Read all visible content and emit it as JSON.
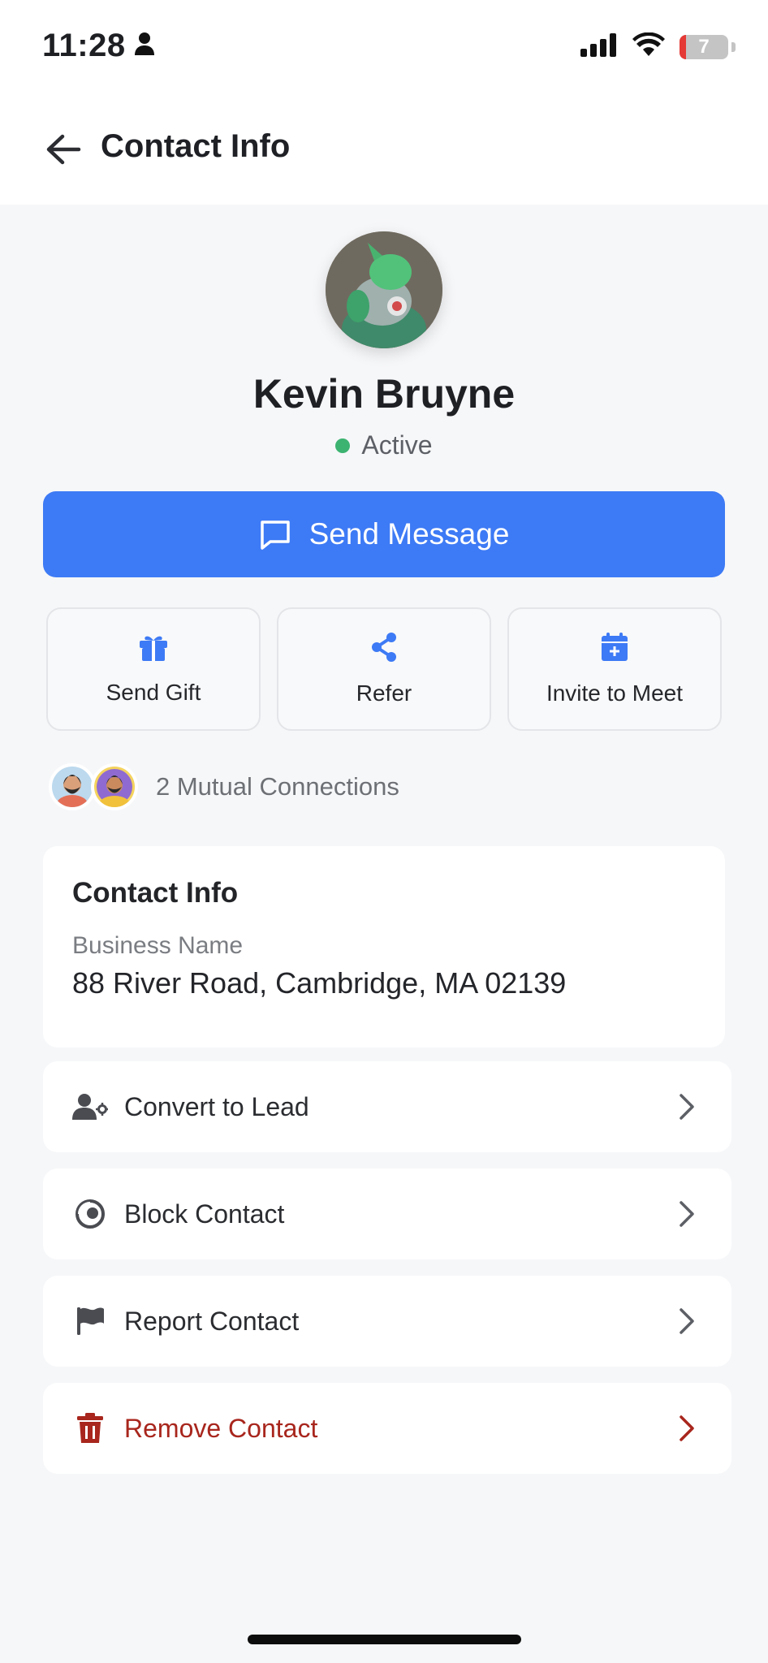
{
  "status_bar": {
    "time": "11:28",
    "battery": "7"
  },
  "header": {
    "title": "Contact Info"
  },
  "profile": {
    "name": "Kevin Bruyne",
    "status": "Active",
    "status_color": "#3cb371"
  },
  "primary_action": {
    "label": "Send Message",
    "color": "#3d7af5"
  },
  "actions": [
    {
      "label": "Send Gift",
      "icon": "gift-icon"
    },
    {
      "label": "Refer",
      "icon": "share-icon"
    },
    {
      "label": "Invite to Meet",
      "icon": "calendar-plus-icon"
    }
  ],
  "mutual": {
    "text": "2 Mutual Connections"
  },
  "contact_info": {
    "title": "Contact Info",
    "label": "Business Name",
    "value": "88 River Road, Cambridge, MA 02139"
  },
  "menu": [
    {
      "label": "Convert to Lead",
      "icon": "user-gear-icon"
    },
    {
      "label": "Block Contact",
      "icon": "block-icon"
    },
    {
      "label": "Report Contact",
      "icon": "flag-icon"
    },
    {
      "label": "Remove Contact",
      "icon": "trash-icon",
      "color": "#a8261d"
    }
  ]
}
